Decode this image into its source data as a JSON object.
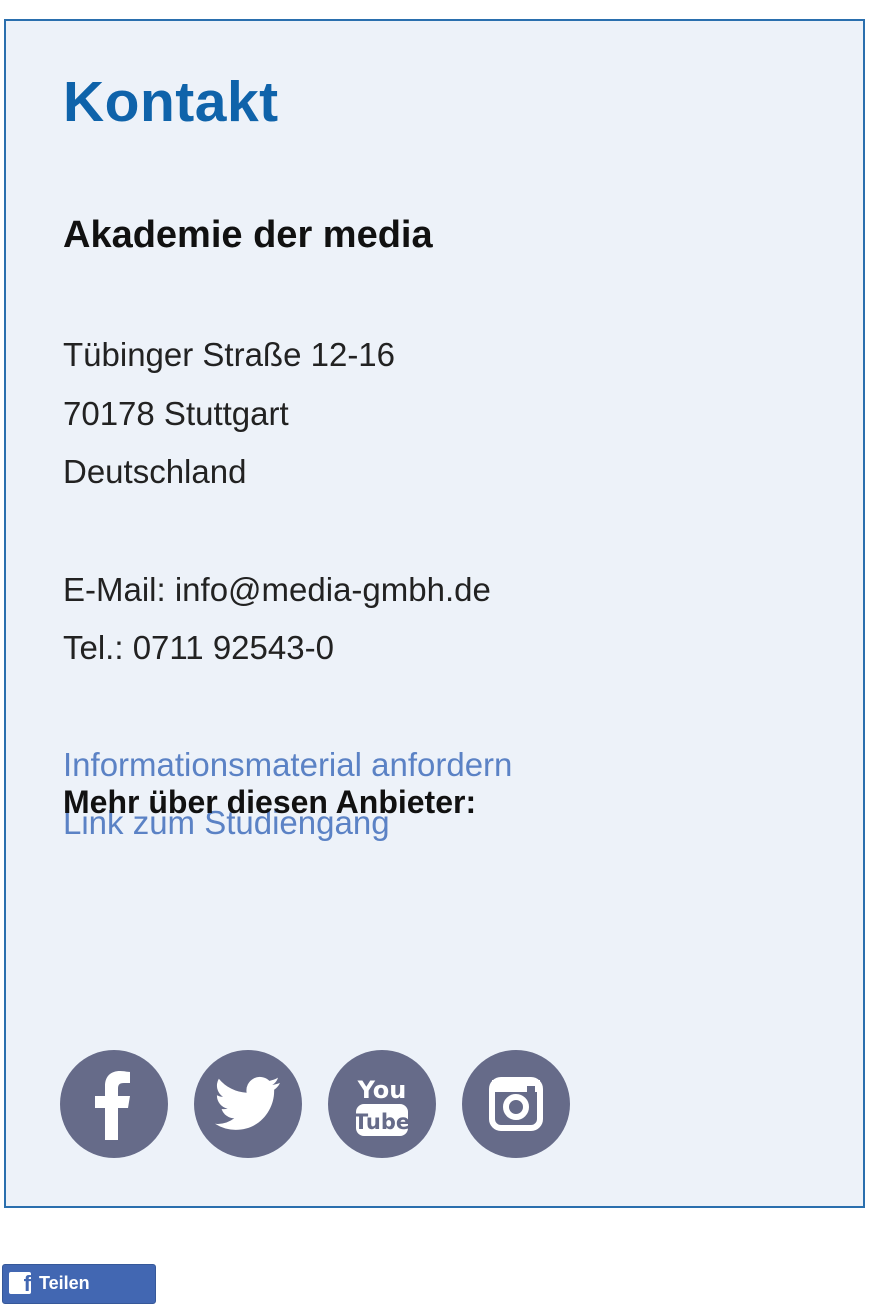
{
  "contact": {
    "title": "Kontakt",
    "organization": "Akademie der media",
    "address": {
      "street": "Tübinger Straße 12-16",
      "city": "70178 Stuttgart",
      "country": "Deutschland"
    },
    "email_line": "E-Mail: info@media-gmbh.de",
    "phone_line": "Tel.: 0711 92543-0",
    "links": {
      "info_material": "Informationsmaterial anfordern",
      "course": "Link zum Studiengang"
    },
    "more_heading": "Mehr über diesen Anbieter:",
    "social": [
      {
        "icon": "facebook-icon"
      },
      {
        "icon": "twitter-icon"
      },
      {
        "icon": "youtube-icon",
        "text_top": "You",
        "text_bottom": "Tube"
      },
      {
        "icon": "instagram-icon"
      }
    ]
  },
  "share_button": {
    "label": "Teilen",
    "icon": "facebook-f-icon",
    "icon_glyph": "f"
  },
  "colors": {
    "title": "#0f63aa",
    "link": "#5b82c5",
    "box_bg": "#edf2f9",
    "box_border": "#2a6fae",
    "social_bg": "#666b89",
    "share_bg": "#4267b2"
  }
}
